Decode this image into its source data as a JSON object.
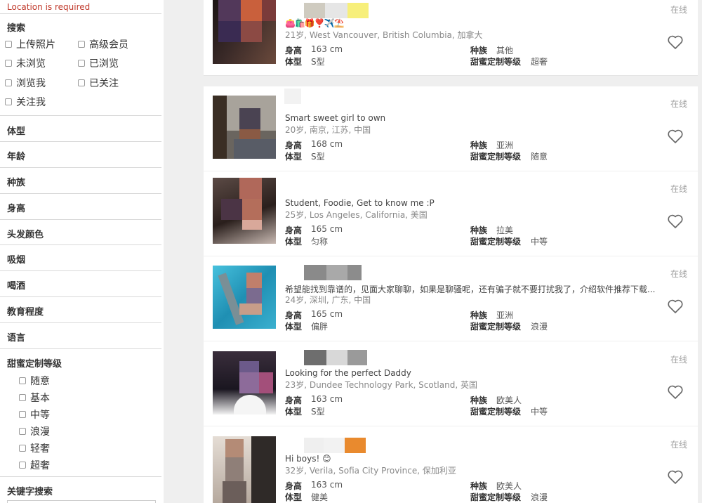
{
  "sidebar": {
    "error": "Location is required",
    "search_label": "搜索",
    "search_options": [
      {
        "label": "上传照片"
      },
      {
        "label": "高级会员"
      },
      {
        "label": "未浏览"
      },
      {
        "label": "已浏览"
      },
      {
        "label": "浏览我"
      },
      {
        "label": "已关注"
      },
      {
        "label": "关注我"
      }
    ],
    "sections": [
      "体型",
      "年龄",
      "种族",
      "身高",
      "头发颜色",
      "吸烟",
      "喝酒",
      "教育程度",
      "语言"
    ],
    "level_label": "甜蜜定制等级",
    "levels": [
      "随意",
      "基本",
      "中等",
      "浪漫",
      "轻奢",
      "超奢"
    ],
    "keyword_label": "关键字搜索"
  },
  "labels": {
    "height": "身高",
    "body": "体型",
    "ethnicity": "种族",
    "level": "甜蜜定制等级",
    "online": "在线"
  },
  "profiles": [
    {
      "headline": "👛🛍️🎁❣️✈️⛱️",
      "location": "21岁, West Vancouver, British Columbia, 加拿大",
      "height": "163 cm",
      "body": "S型",
      "ethnicity": "其他",
      "level": "超奢",
      "online": "在线"
    },
    {
      "headline": "Smart sweet girl to own",
      "location": "20岁, 南京, 江苏, 中国",
      "height": "168 cm",
      "body": "S型",
      "ethnicity": "亚洲",
      "level": "随意",
      "online": "在线"
    },
    {
      "headline": "Student, Foodie, Get to know me :P",
      "location": "25岁, Los Angeles, California, 美国",
      "height": "165 cm",
      "body": "匀称",
      "ethnicity": "拉美",
      "level": "中等",
      "online": "在线"
    },
    {
      "headline": "希望能找到靠谱的，见面大家聊聊，如果是聊骚呢，还有骗子就不要打扰我了，介绍软件推荐下载...",
      "location": "24岁, 深圳, 广东, 中国",
      "height": "165 cm",
      "body": "偏胖",
      "ethnicity": "亚洲",
      "level": "浪漫",
      "online": "在线"
    },
    {
      "headline": "Looking for the perfect Daddy",
      "location": "23岁, Dundee Technology Park, Scotland, 英国",
      "height": "163 cm",
      "body": "S型",
      "ethnicity": "欧美人",
      "level": "中等",
      "online": "在线"
    },
    {
      "headline": "Hi boys! 😊",
      "location": "32岁, Verila, Sofia City Province, 保加利亚",
      "height": "163 cm",
      "body": "健美",
      "ethnicity": "欧美人",
      "level": "浪漫",
      "online": "在线"
    }
  ],
  "colors": {
    "error": "#c0392b",
    "heart": "#666666",
    "page_bg": "#efefef"
  },
  "icons": {
    "favorite": "heart-outline-icon"
  }
}
